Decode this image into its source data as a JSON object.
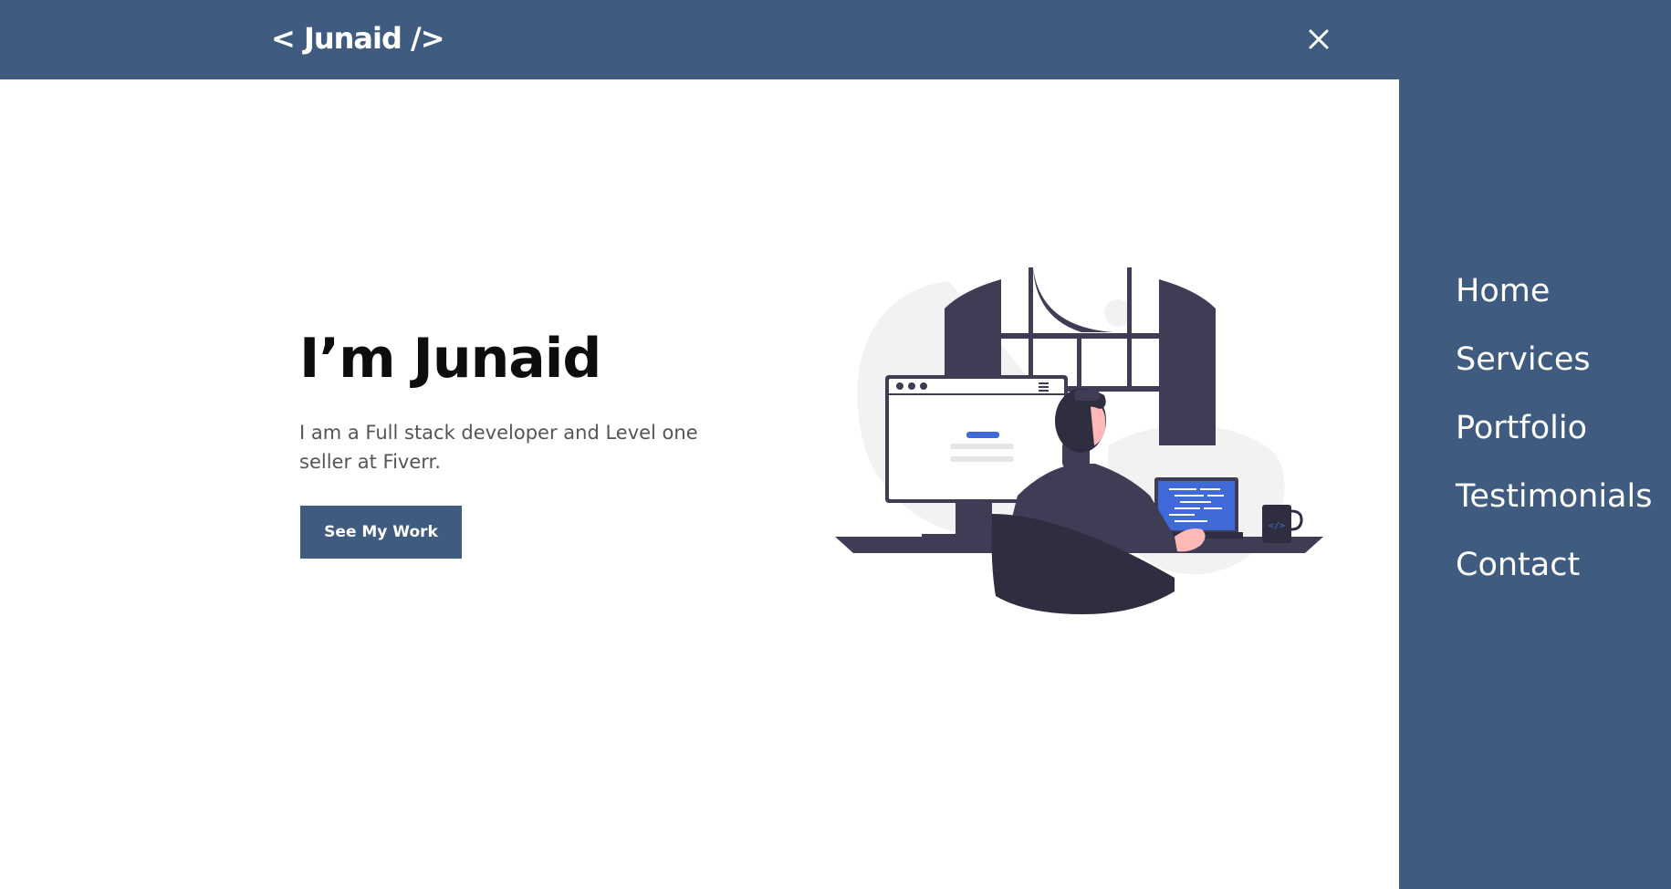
{
  "header": {
    "logo_text": "< Junaid />",
    "close_icon": "close-icon"
  },
  "hero": {
    "title": "I’m Junaid",
    "description": "I am a Full stack developer and Level one seller at Fiverr.",
    "cta_label": "See My Work",
    "illustration_icon": "developer-at-desk-illustration"
  },
  "nav": {
    "items": [
      {
        "label": "Home"
      },
      {
        "label": "Services"
      },
      {
        "label": "Portfolio"
      },
      {
        "label": "Testimonials"
      },
      {
        "label": "Contact"
      }
    ]
  },
  "colors": {
    "brand": "#3f5b80",
    "background": "#ffffff",
    "heading": "#0d0d0d",
    "body_text": "#555555",
    "illustration_dark": "#3f3d56",
    "illustration_accent": "#3f6ad8"
  }
}
